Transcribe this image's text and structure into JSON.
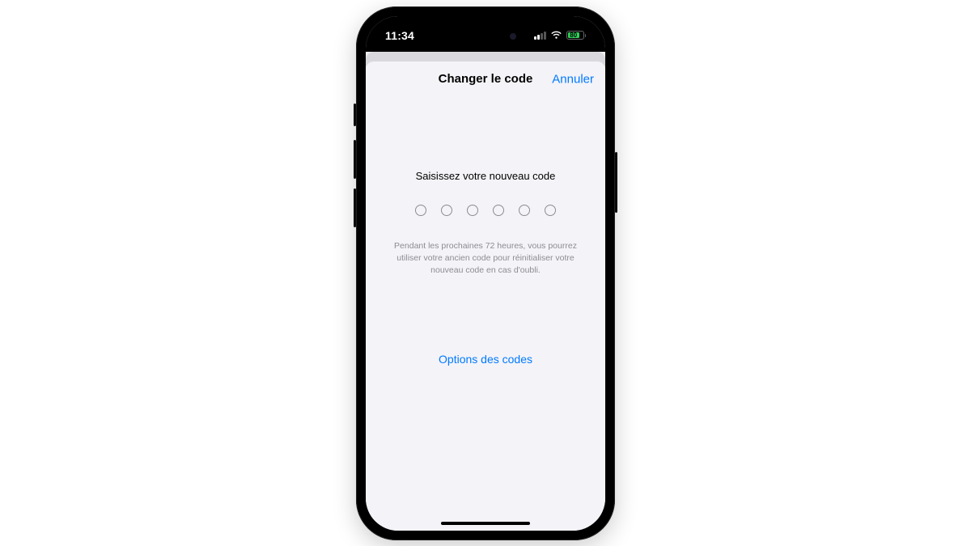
{
  "status_bar": {
    "time": "11:34",
    "battery_percent": "80"
  },
  "sheet": {
    "nav_title": "Changer le code",
    "cancel_label": "Annuler",
    "prompt": "Saisissez votre nouveau code",
    "passcode_length": 6,
    "info_text": "Pendant les prochaines 72 heures, vous pourrez utiliser votre ancien code pour réinitialiser votre nouveau code en cas d'oubli.",
    "options_label": "Options des codes"
  },
  "colors": {
    "link": "#007aff",
    "background": "#f4f3f8"
  }
}
